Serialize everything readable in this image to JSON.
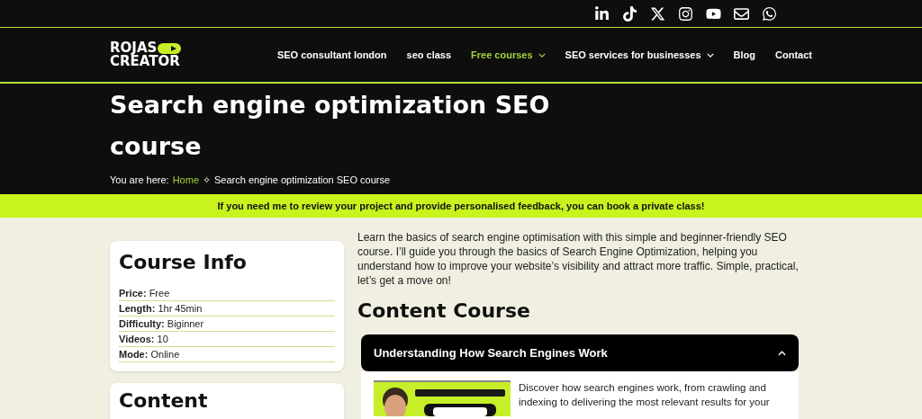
{
  "logo": {
    "line_1": "ROJAS",
    "line_2": "CREATOR"
  },
  "nav": [
    {
      "label": "SEO consultant london",
      "selected": false,
      "dropdown": false
    },
    {
      "label": "seo class",
      "selected": false,
      "dropdown": false
    },
    {
      "label": "Free courses",
      "selected": true,
      "dropdown": true
    },
    {
      "label": "SEO services for businesses",
      "selected": false,
      "dropdown": true
    },
    {
      "label": "Blog",
      "selected": false,
      "dropdown": false
    },
    {
      "label": "Contact",
      "selected": false,
      "dropdown": false
    }
  ],
  "hero": {
    "title": "Search engine optimization SEO course",
    "breadcrumb_prefix": "You are here:",
    "breadcrumb_link": "Home",
    "breadcrumb_separator": "✧",
    "breadcrumb_current": "Search engine optimization SEO course"
  },
  "banner": "If you need me to review your project and provide personalised feedback, you can book a private class!",
  "course_info": {
    "title": "Course Info",
    "rows": [
      {
        "label": "Price:",
        "value": "Free"
      },
      {
        "label": "Length:",
        "value": "1hr 45min"
      },
      {
        "label": "Difficulty:",
        "value": "Biginner"
      },
      {
        "label": "Videos:",
        "value": "10"
      },
      {
        "label": "Mode:",
        "value": "Online"
      }
    ]
  },
  "content_card": {
    "title": "Content"
  },
  "intro": "Learn the basics of search engine optimisation with this simple and beginner-friendly SEO course. I’ll guide you through the basics of Search Engine Optimization, helping you understand how to improve your website’s visibility and attract more traffic. Simple, practical, let’s get a move on!",
  "content_heading": "Content Course",
  "accordion": [
    {
      "title": "Understanding How Search Engines Work",
      "expanded": true,
      "text": "Discover how search engines work, from crawling and indexing to delivering the most relevant results for your"
    }
  ]
}
